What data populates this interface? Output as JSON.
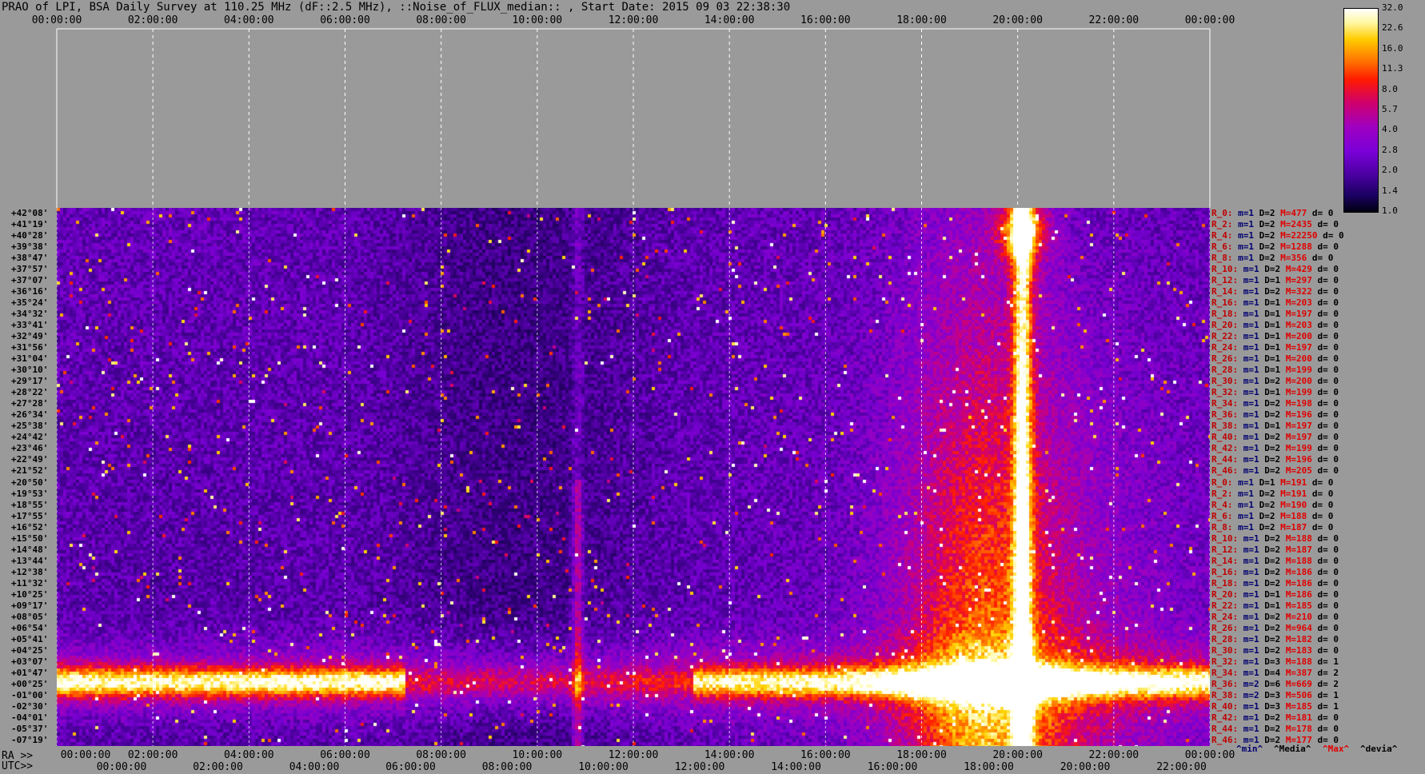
{
  "chart_data": {
    "type": "heatmap",
    "title": "PRAO of LPI, BSA Daily Survey at 110.25 MHz (dF::2.5 MHz), ::Noise_of_FLUX_median:: , Start Date: 2015 09 03 22:38:30",
    "top_axis_ticks": [
      "00:00:00",
      "02:00:00",
      "04:00:00",
      "06:00:00",
      "08:00:00",
      "10:00:00",
      "12:00:00",
      "14:00:00",
      "16:00:00",
      "18:00:00",
      "20:00:00",
      "22:00:00",
      "00:00:00"
    ],
    "ra_prefix": "RA >>",
    "ra_axis_ticks": [
      "00:00:00",
      "02:00:00",
      "04:00:00",
      "06:00:00",
      "08:00:00",
      "10:00:00",
      "12:00:00",
      "14:00:00",
      "16:00:00",
      "18:00:00",
      "20:00:00",
      "22:00:00",
      "00:00:00"
    ],
    "utc_prefix": "UTC>>",
    "utc_axis_ticks": [
      "00:00:00",
      "02:00:00",
      "04:00:00",
      "06:00:00",
      "08:00:00",
      "10:00:00",
      "12:00:00",
      "14:00:00",
      "16:00:00",
      "18:00:00",
      "20:00:00",
      "22:00:00"
    ],
    "y_labels": [
      "+42°08'",
      "+41°19'",
      "+40°28'",
      "+39°38'",
      "+38°47'",
      "+37°57'",
      "+37°07'",
      "+36°16'",
      "+35°24'",
      "+34°32'",
      "+33°41'",
      "+32°49'",
      "+31°56'",
      "+31°04'",
      "+30°10'",
      "+29°17'",
      "+28°22'",
      "+27°28'",
      "+26°34'",
      "+25°38'",
      "+24°42'",
      "+23°46'",
      "+22°49'",
      "+21°52'",
      "+20°50'",
      "+19°53'",
      "+18°55'",
      "+17°55'",
      "+16°52'",
      "+15°50'",
      "+14°48'",
      "+13°44'",
      "+12°38'",
      "+11°32'",
      "+10°25'",
      "+09°17'",
      "+08°05'",
      "+06°54'",
      "+05°41'",
      "+04°25'",
      "+03°07'",
      "+01°47'",
      "+00°25'",
      "-01°00'",
      "-02°30'",
      "-04°01'",
      "-05°37'",
      "-07°19'"
    ],
    "colorbar_ticks": [
      "32.0",
      "22.6",
      "16.0",
      "11.3",
      "8.0",
      "5.7",
      "4.0",
      "2.8",
      "2.0",
      "1.4",
      "1.0"
    ],
    "colorbar_scale": "log",
    "row_stats": [
      {
        "r": "R_0:",
        "m": "m=1",
        "D": "D=2",
        "M": "M=477",
        "d": "d= 0"
      },
      {
        "r": "R_2:",
        "m": "m=1",
        "D": "D=2",
        "M": "M=2435",
        "d": "d= 0"
      },
      {
        "r": "R_4:",
        "m": "m=1",
        "D": "D=2",
        "M": "M=22250",
        "d": "d= 0"
      },
      {
        "r": "R_6:",
        "m": "m=1",
        "D": "D=2",
        "M": "M=1288",
        "d": "d= 0"
      },
      {
        "r": "R_8:",
        "m": "m=1",
        "D": "D=2",
        "M": "M=356",
        "d": "d= 0"
      },
      {
        "r": "R_10:",
        "m": "m=1",
        "D": "D=2",
        "M": "M=429",
        "d": "d= 0"
      },
      {
        "r": "R_12:",
        "m": "m=1",
        "D": "D=1",
        "M": "M=297",
        "d": "d= 0"
      },
      {
        "r": "R_14:",
        "m": "m=1",
        "D": "D=2",
        "M": "M=322",
        "d": "d= 0"
      },
      {
        "r": "R_16:",
        "m": "m=1",
        "D": "D=1",
        "M": "M=203",
        "d": "d= 0"
      },
      {
        "r": "R_18:",
        "m": "m=1",
        "D": "D=1",
        "M": "M=197",
        "d": "d= 0"
      },
      {
        "r": "R_20:",
        "m": "m=1",
        "D": "D=1",
        "M": "M=203",
        "d": "d= 0"
      },
      {
        "r": "R_22:",
        "m": "m=1",
        "D": "D=1",
        "M": "M=200",
        "d": "d= 0"
      },
      {
        "r": "R_24:",
        "m": "m=1",
        "D": "D=1",
        "M": "M=197",
        "d": "d= 0"
      },
      {
        "r": "R_26:",
        "m": "m=1",
        "D": "D=1",
        "M": "M=200",
        "d": "d= 0"
      },
      {
        "r": "R_28:",
        "m": "m=1",
        "D": "D=1",
        "M": "M=199",
        "d": "d= 0"
      },
      {
        "r": "R_30:",
        "m": "m=1",
        "D": "D=2",
        "M": "M=200",
        "d": "d= 0"
      },
      {
        "r": "R_32:",
        "m": "m=1",
        "D": "D=1",
        "M": "M=199",
        "d": "d= 0"
      },
      {
        "r": "R_34:",
        "m": "m=1",
        "D": "D=2",
        "M": "M=198",
        "d": "d= 0"
      },
      {
        "r": "R_36:",
        "m": "m=1",
        "D": "D=2",
        "M": "M=196",
        "d": "d= 0"
      },
      {
        "r": "R_38:",
        "m": "m=1",
        "D": "D=1",
        "M": "M=197",
        "d": "d= 0"
      },
      {
        "r": "R_40:",
        "m": "m=1",
        "D": "D=2",
        "M": "M=197",
        "d": "d= 0"
      },
      {
        "r": "R_42:",
        "m": "m=1",
        "D": "D=2",
        "M": "M=199",
        "d": "d= 0"
      },
      {
        "r": "R_44:",
        "m": "m=1",
        "D": "D=2",
        "M": "M=196",
        "d": "d= 0"
      },
      {
        "r": "R_46:",
        "m": "m=1",
        "D": "D=2",
        "M": "M=205",
        "d": "d= 0"
      },
      {
        "r": "R_0:",
        "m": "m=1",
        "D": "D=1",
        "M": "M=191",
        "d": "d= 0"
      },
      {
        "r": "R_2:",
        "m": "m=1",
        "D": "D=2",
        "M": "M=191",
        "d": "d= 0"
      },
      {
        "r": "R_4:",
        "m": "m=1",
        "D": "D=2",
        "M": "M=190",
        "d": "d= 0"
      },
      {
        "r": "R_6:",
        "m": "m=1",
        "D": "D=2",
        "M": "M=188",
        "d": "d= 0"
      },
      {
        "r": "R_8:",
        "m": "m=1",
        "D": "D=2",
        "M": "M=187",
        "d": "d= 0"
      },
      {
        "r": "R_10:",
        "m": "m=1",
        "D": "D=2",
        "M": "M=188",
        "d": "d= 0"
      },
      {
        "r": "R_12:",
        "m": "m=1",
        "D": "D=2",
        "M": "M=187",
        "d": "d= 0"
      },
      {
        "r": "R_14:",
        "m": "m=1",
        "D": "D=2",
        "M": "M=188",
        "d": "d= 0"
      },
      {
        "r": "R_16:",
        "m": "m=1",
        "D": "D=2",
        "M": "M=186",
        "d": "d= 0"
      },
      {
        "r": "R_18:",
        "m": "m=1",
        "D": "D=2",
        "M": "M=186",
        "d": "d= 0"
      },
      {
        "r": "R_20:",
        "m": "m=1",
        "D": "D=1",
        "M": "M=186",
        "d": "d= 0"
      },
      {
        "r": "R_22:",
        "m": "m=1",
        "D": "D=1",
        "M": "M=185",
        "d": "d= 0"
      },
      {
        "r": "R_24:",
        "m": "m=1",
        "D": "D=2",
        "M": "M=210",
        "d": "d= 0"
      },
      {
        "r": "R_26:",
        "m": "m=1",
        "D": "D=2",
        "M": "M=964",
        "d": "d= 0"
      },
      {
        "r": "R_28:",
        "m": "m=1",
        "D": "D=2",
        "M": "M=182",
        "d": "d= 0"
      },
      {
        "r": "R_30:",
        "m": "m=1",
        "D": "D=2",
        "M": "M=183",
        "d": "d= 0"
      },
      {
        "r": "R_32:",
        "m": "m=1",
        "D": "D=3",
        "M": "M=188",
        "d": "d= 1"
      },
      {
        "r": "R_34:",
        "m": "m=1",
        "D": "D=4",
        "M": "M=387",
        "d": "d= 2"
      },
      {
        "r": "R_36:",
        "m": "m=2",
        "D": "D=6",
        "M": "M=669",
        "d": "d= 2"
      },
      {
        "r": "R_38:",
        "m": "m=2",
        "D": "D=3",
        "M": "M=506",
        "d": "d= 1"
      },
      {
        "r": "R_40:",
        "m": "m=1",
        "D": "D=3",
        "M": "M=185",
        "d": "d= 1"
      },
      {
        "r": "R_42:",
        "m": "m=1",
        "D": "D=2",
        "M": "M=181",
        "d": "d= 0"
      },
      {
        "r": "R_44:",
        "m": "m=1",
        "D": "D=2",
        "M": "M=178",
        "d": "d= 0"
      },
      {
        "r": "R_46:",
        "m": "m=1",
        "D": "D=2",
        "M": "M=177",
        "d": "d= 0"
      }
    ],
    "legend": [
      {
        "text": "^min^",
        "color": "#000070"
      },
      {
        "text": "^Media^",
        "color": "#000000"
      },
      {
        "text": "^Max^",
        "color": "#e00000"
      },
      {
        "text": "^devia^",
        "color": "#000000"
      }
    ]
  }
}
